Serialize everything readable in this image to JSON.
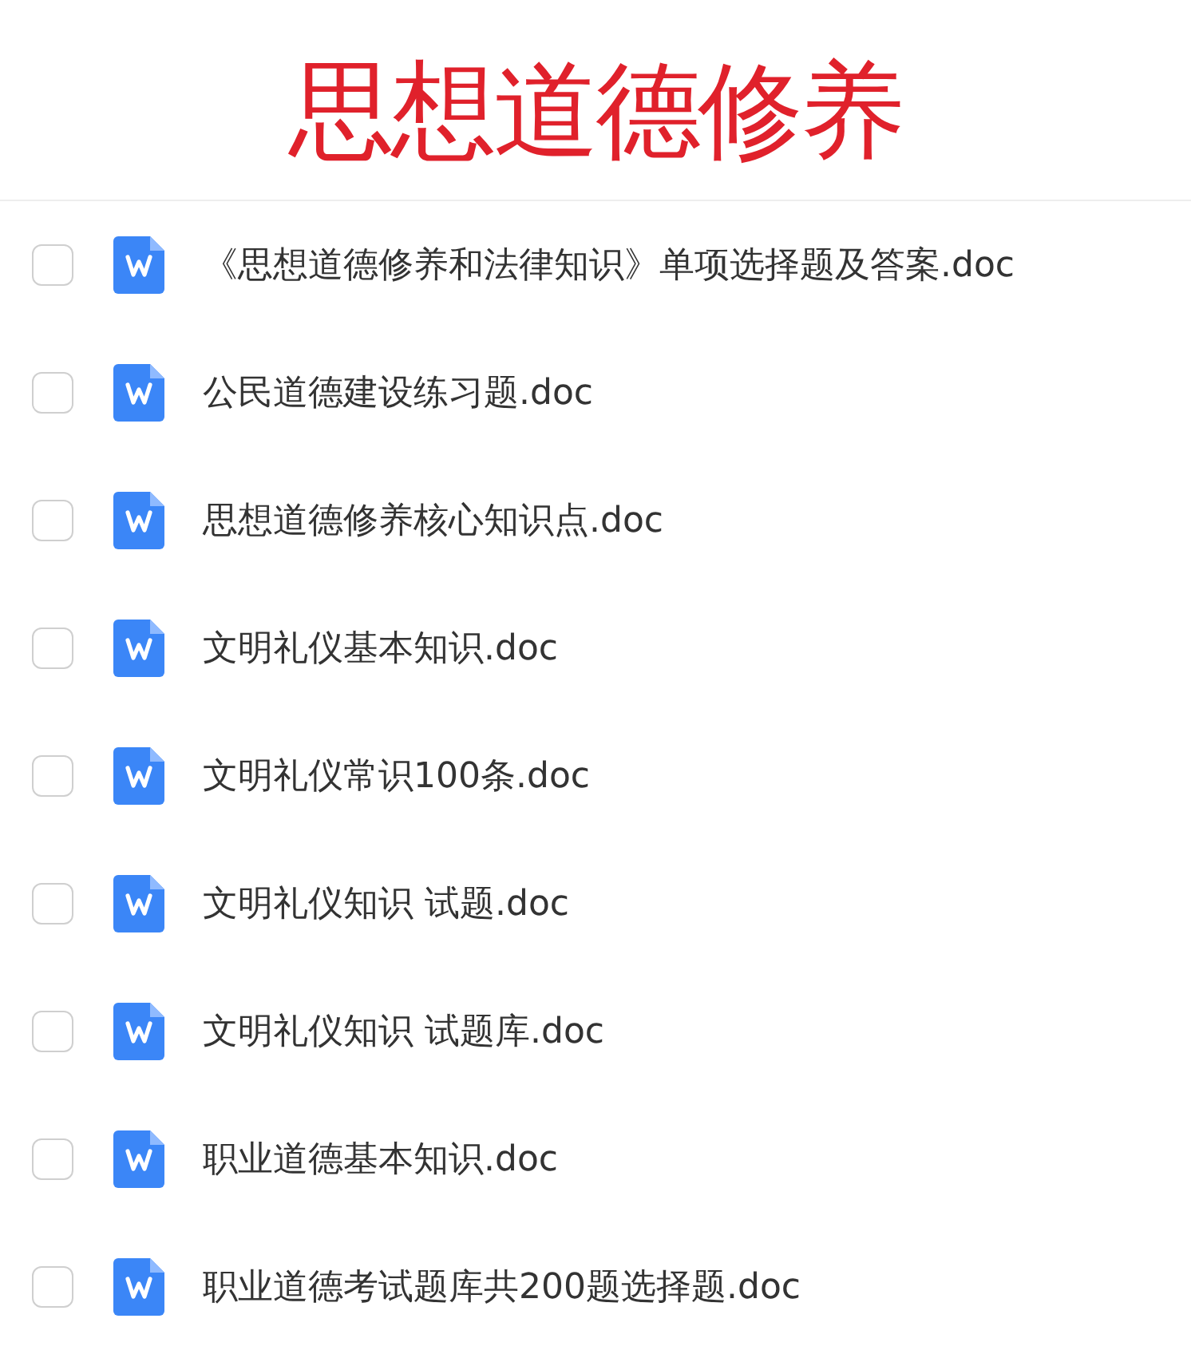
{
  "title": "思想道德修养",
  "files": [
    {
      "name": "《思想道德修养和法律知识》单项选择题及答案.doc",
      "checked": false
    },
    {
      "name": "公民道德建设练习题.doc",
      "checked": false
    },
    {
      "name": "思想道德修养核心知识点.doc",
      "checked": false
    },
    {
      "name": "文明礼仪基本知识.doc",
      "checked": false
    },
    {
      "name": "文明礼仪常识100条.doc",
      "checked": false
    },
    {
      "name": "文明礼仪知识 试题.doc",
      "checked": false
    },
    {
      "name": "文明礼仪知识 试题库.doc",
      "checked": false
    },
    {
      "name": "职业道德基本知识.doc",
      "checked": false
    },
    {
      "name": "职业道德考试题库共200题选择题.doc",
      "checked": false
    }
  ]
}
